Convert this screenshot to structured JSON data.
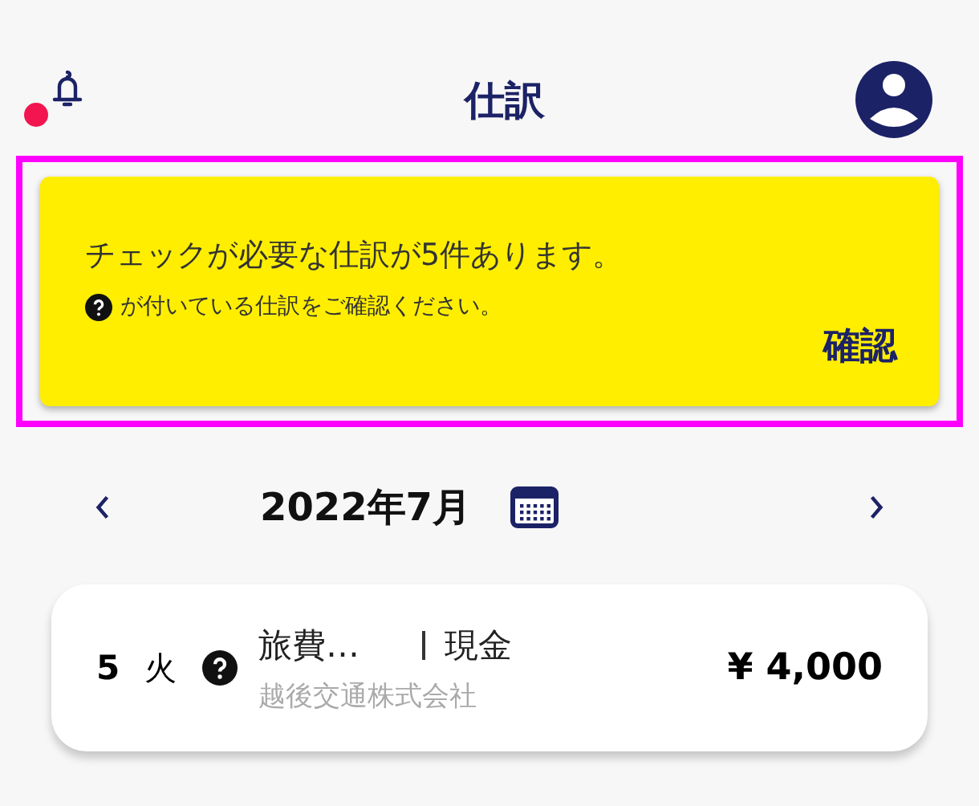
{
  "header": {
    "title": "仕訳",
    "has_notification": true
  },
  "banner": {
    "highlighted": true,
    "message": "チェックが必要な仕訳が5件あります。",
    "hint": "が付いている仕訳をご確認ください。",
    "action": "確認"
  },
  "month_nav": {
    "label": "2022年7月"
  },
  "entries": [
    {
      "day": "5",
      "weekday": "火",
      "needs_check": true,
      "account": "旅費…",
      "payment": "現金",
      "partner": "越後交通株式会社",
      "amount": "¥ 4,000"
    }
  ]
}
